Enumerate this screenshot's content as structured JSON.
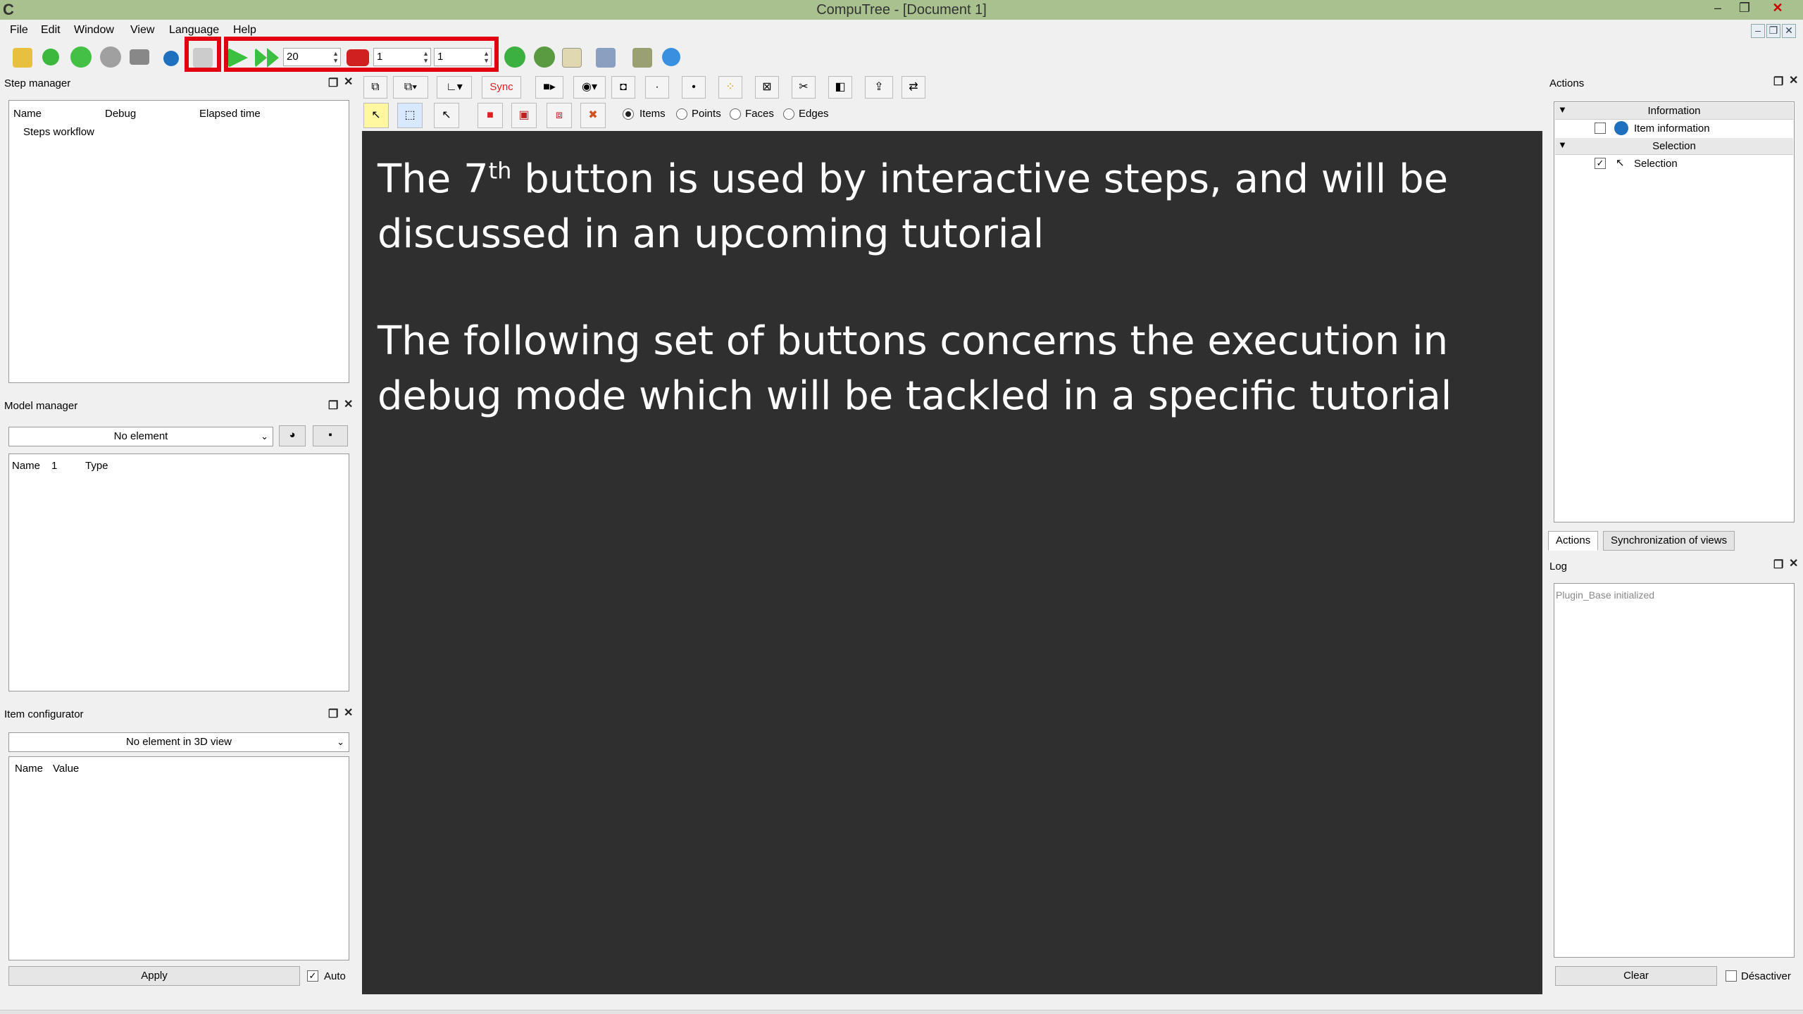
{
  "window": {
    "title": "CompuTree - [Document 1]",
    "app_glyph": "C",
    "min": "–",
    "restore": "❐",
    "close": "✕"
  },
  "menu": [
    "File",
    "Edit",
    "Window",
    "View",
    "Language",
    "Help"
  ],
  "toolbar": {
    "step_count": "20",
    "debug_jump": "1",
    "debug_step": "1"
  },
  "step_manager": {
    "title": "Step manager",
    "columns": [
      "Name",
      "Debug",
      "Elapsed time"
    ],
    "root_item": "Steps workflow"
  },
  "model_manager": {
    "title": "Model manager",
    "combo": "No element",
    "columns": [
      "Name",
      "1",
      "Type"
    ]
  },
  "item_configurator": {
    "title": "Item configurator",
    "combo": "No element in 3D view",
    "columns": [
      "Name",
      "Value"
    ],
    "apply": "Apply",
    "auto": "Auto"
  },
  "view_toolbar": {
    "sync": "Sync",
    "radios": [
      "Items",
      "Points",
      "Faces",
      "Edges"
    ]
  },
  "viewport": {
    "para1_a": "The 7",
    "para1_sup": "th",
    "para1_b": " button is used by interactive steps, and will be discussed in an upcoming tutorial",
    "para2": "The following set of buttons concerns the execution in debug mode which will be tackled in a specific tutorial"
  },
  "actions": {
    "title": "Actions",
    "section_information": "Information",
    "item_information": "Item information",
    "section_selection": "Selection",
    "selection": "Selection",
    "tabs": [
      "Actions",
      "Synchronization of views"
    ]
  },
  "log": {
    "title": "Log",
    "message": "Plugin_Base initialized",
    "clear": "Clear",
    "disable": "Désactiver"
  },
  "colors": {
    "titlebar": "#a9c08f",
    "viewport": "#2f2f2f",
    "highlight": "#e00010"
  }
}
